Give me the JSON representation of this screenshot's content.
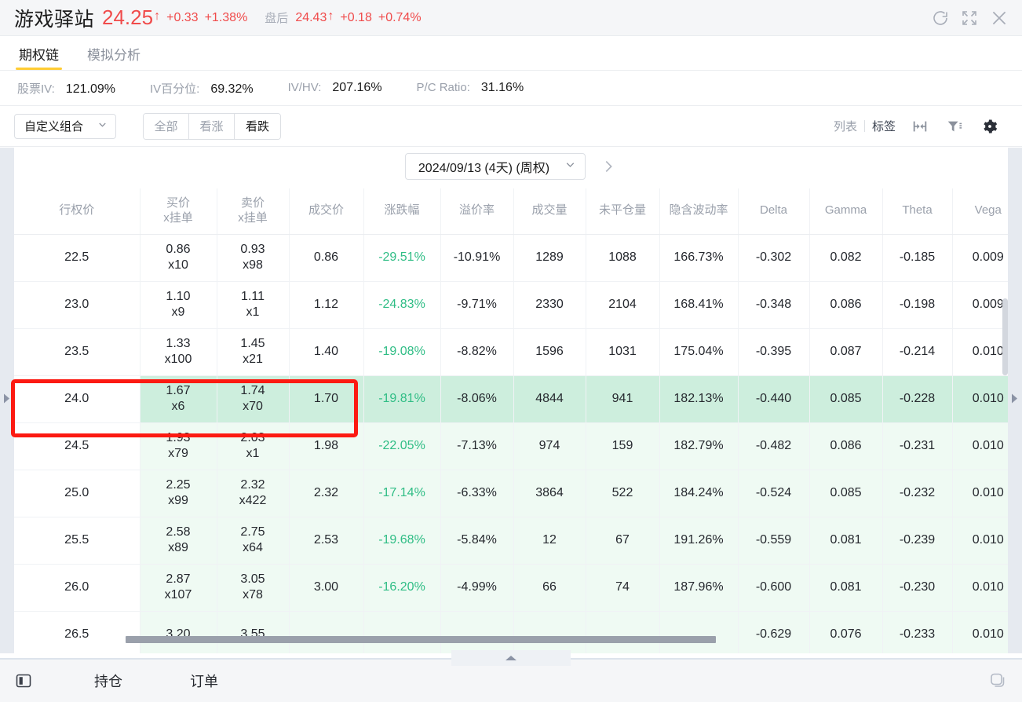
{
  "header": {
    "symbol_name": "游戏驿站",
    "price": "24.25",
    "arrow": "↑",
    "change": "+0.33",
    "change_pct": "+1.38%",
    "post_label": "盘后",
    "post_price": "24.43",
    "post_arrow": "↑",
    "post_change": "+0.18",
    "post_change_pct": "+0.74%",
    "icons": [
      "refresh-icon",
      "fullscreen-icon",
      "close-icon"
    ],
    "up_color": "#f04b4b"
  },
  "tabs": [
    {
      "label": "期权链",
      "active": true
    },
    {
      "label": "模拟分析",
      "active": false
    }
  ],
  "iv_stats": [
    {
      "label": "股票IV:",
      "value": "121.09%"
    },
    {
      "label": "IV百分位:",
      "value": "69.32%"
    },
    {
      "label": "IV/HV:",
      "value": "207.16%"
    },
    {
      "label": "P/C Ratio:",
      "value": "31.16%"
    }
  ],
  "toolbar": {
    "combo_label": "自定义组合",
    "segments": [
      {
        "label": "全部",
        "active": false
      },
      {
        "label": "看涨",
        "active": false
      },
      {
        "label": "看跌",
        "active": true
      }
    ],
    "view_list": "列表",
    "view_tag": "标签",
    "icons": [
      "collapse-columns-icon",
      "filter-icon",
      "gear-icon"
    ]
  },
  "date_selector": {
    "value": "2024/09/13 (4天) (周权)",
    "next_label": "›"
  },
  "table": {
    "columns": [
      {
        "label": "行权价",
        "sub": ""
      },
      {
        "label": "买价",
        "sub": "x挂单"
      },
      {
        "label": "卖价",
        "sub": "x挂单"
      },
      {
        "label": "成交价",
        "sub": ""
      },
      {
        "label": "涨跌幅",
        "sub": ""
      },
      {
        "label": "溢价率",
        "sub": ""
      },
      {
        "label": "成交量",
        "sub": ""
      },
      {
        "label": "未平仓量",
        "sub": ""
      },
      {
        "label": "隐含波动率",
        "sub": ""
      },
      {
        "label": "Delta",
        "sub": ""
      },
      {
        "label": "Gamma",
        "sub": ""
      },
      {
        "label": "Theta",
        "sub": ""
      },
      {
        "label": "Vega",
        "sub": ""
      }
    ],
    "rows": [
      {
        "strike": "22.5",
        "bid": "0.86",
        "bid_size": "x10",
        "ask": "0.93",
        "ask_size": "x98",
        "last": "0.86",
        "change_pct": "-29.51%",
        "premium_pct": "-10.91%",
        "volume": "1289",
        "open_interest": "1088",
        "iv": "166.73%",
        "delta": "-0.302",
        "gamma": "0.082",
        "theta": "-0.185",
        "vega": "0.009",
        "tint": false,
        "highlighted": false
      },
      {
        "strike": "23.0",
        "bid": "1.10",
        "bid_size": "x9",
        "ask": "1.11",
        "ask_size": "x1",
        "last": "1.12",
        "change_pct": "-24.83%",
        "premium_pct": "-9.71%",
        "volume": "2330",
        "open_interest": "2104",
        "iv": "168.41%",
        "delta": "-0.348",
        "gamma": "0.086",
        "theta": "-0.198",
        "vega": "0.009",
        "tint": false,
        "highlighted": false
      },
      {
        "strike": "23.5",
        "bid": "1.33",
        "bid_size": "x100",
        "ask": "1.45",
        "ask_size": "x21",
        "last": "1.40",
        "change_pct": "-19.08%",
        "premium_pct": "-8.82%",
        "volume": "1596",
        "open_interest": "1031",
        "iv": "175.04%",
        "delta": "-0.395",
        "gamma": "0.087",
        "theta": "-0.214",
        "vega": "0.010",
        "tint": false,
        "highlighted": false
      },
      {
        "strike": "24.0",
        "bid": "1.67",
        "bid_size": "x6",
        "ask": "1.74",
        "ask_size": "x70",
        "last": "1.70",
        "change_pct": "-19.81%",
        "premium_pct": "-8.06%",
        "volume": "4844",
        "open_interest": "941",
        "iv": "182.13%",
        "delta": "-0.440",
        "gamma": "0.085",
        "theta": "-0.228",
        "vega": "0.010",
        "tint": false,
        "highlighted": true
      },
      {
        "strike": "24.5",
        "bid": "1.93",
        "bid_size": "x79",
        "ask": "2.03",
        "ask_size": "x1",
        "last": "1.98",
        "change_pct": "-22.05%",
        "premium_pct": "-7.13%",
        "volume": "974",
        "open_interest": "159",
        "iv": "182.79%",
        "delta": "-0.482",
        "gamma": "0.086",
        "theta": "-0.231",
        "vega": "0.010",
        "tint": true,
        "highlighted": false
      },
      {
        "strike": "25.0",
        "bid": "2.25",
        "bid_size": "x99",
        "ask": "2.32",
        "ask_size": "x422",
        "last": "2.32",
        "change_pct": "-17.14%",
        "premium_pct": "-6.33%",
        "volume": "3864",
        "open_interest": "522",
        "iv": "184.24%",
        "delta": "-0.524",
        "gamma": "0.085",
        "theta": "-0.232",
        "vega": "0.010",
        "tint": true,
        "highlighted": false
      },
      {
        "strike": "25.5",
        "bid": "2.58",
        "bid_size": "x89",
        "ask": "2.75",
        "ask_size": "x64",
        "last": "2.53",
        "change_pct": "-19.68%",
        "premium_pct": "-5.84%",
        "volume": "12",
        "open_interest": "67",
        "iv": "191.26%",
        "delta": "-0.559",
        "gamma": "0.081",
        "theta": "-0.239",
        "vega": "0.010",
        "tint": true,
        "highlighted": false
      },
      {
        "strike": "26.0",
        "bid": "2.87",
        "bid_size": "x107",
        "ask": "3.05",
        "ask_size": "x78",
        "last": "3.00",
        "change_pct": "-16.20%",
        "premium_pct": "-4.99%",
        "volume": "66",
        "open_interest": "74",
        "iv": "187.96%",
        "delta": "-0.600",
        "gamma": "0.081",
        "theta": "-0.230",
        "vega": "0.010",
        "tint": true,
        "highlighted": false
      },
      {
        "strike": "26.5",
        "bid": "3.20",
        "bid_size": "",
        "ask": "3.55",
        "ask_size": "",
        "last": "",
        "change_pct": "",
        "premium_pct": "",
        "volume": "",
        "open_interest": "",
        "iv": "",
        "delta": "-0.629",
        "gamma": "0.076",
        "theta": "-0.233",
        "vega": "0.010",
        "tint": true,
        "highlighted": false
      }
    ],
    "down_color": "#2fbd85",
    "highlight_color": "#cdeedd",
    "tint_color": "#effaf3"
  },
  "annotation": {
    "name": "red-highlight-box",
    "color": "#fc1a12"
  },
  "bottom_bar": {
    "panel_icon": "panel-toggle-icon",
    "items": [
      {
        "label": "持仓"
      },
      {
        "label": "订单"
      }
    ],
    "right_icon": "windows-stack-icon"
  }
}
